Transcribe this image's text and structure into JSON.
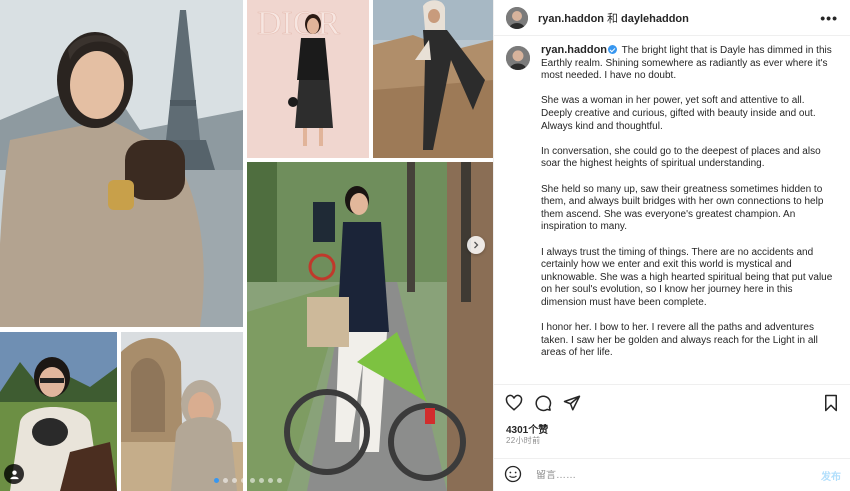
{
  "header": {
    "author": "ryan.haddon",
    "separator": "和",
    "collaborator": "daylehaddon",
    "more_label": "•••"
  },
  "photos": {
    "dior_sign_text": "DIOR"
  },
  "caption": {
    "username": "ryan.haddon",
    "paragraphs": [
      "The bright light that is Dayle has dimmed in this Earthly realm. Shining somewhere as radiantly as ever where it's most needed. I have no doubt.",
      "She was a woman in her power, yet soft and attentive to all. Deeply creative and curious, gifted with beauty inside and out. Always kind and thoughtful.",
      "In conversation, she could go to the deepest of places and also soar the highest heights of spiritual understanding.",
      "She held so many up, saw their greatness sometimes hidden to them, and always built bridges with her own connections to help them ascend. She was everyone's greatest champion. An inspiration to many.",
      "I always trust the timing of things. There are no accidents and certainly how we enter and exit this world is mystical and unknowable. She was a high hearted spiritual being that put value on her soul's evolution, so I know her journey here in this dimension must have been complete.",
      "I honor her. I bow to her. I revere all the paths and adventures taken. I saw her be golden and always reach for the Light in all areas of her life."
    ]
  },
  "stats": {
    "likes": "4301",
    "likes_suffix": "个赞",
    "time_ago": "22小时前"
  },
  "comment": {
    "placeholder": "留言……",
    "post_label": "发布"
  },
  "icons": {
    "like": "heart-icon",
    "comment": "comment-icon",
    "share": "paper-plane-icon",
    "save": "bookmark-icon",
    "emoji": "smiley-icon",
    "verified": "verified-badge-icon",
    "tag": "user-tag-icon",
    "next": "chevron-right-icon"
  },
  "carousel": {
    "slide_count": 8,
    "active_index": 0
  },
  "colors": {
    "accent": "#3897f0",
    "text": "#262626",
    "muted": "#8e8e8e",
    "bike_green": "#7dc241"
  }
}
